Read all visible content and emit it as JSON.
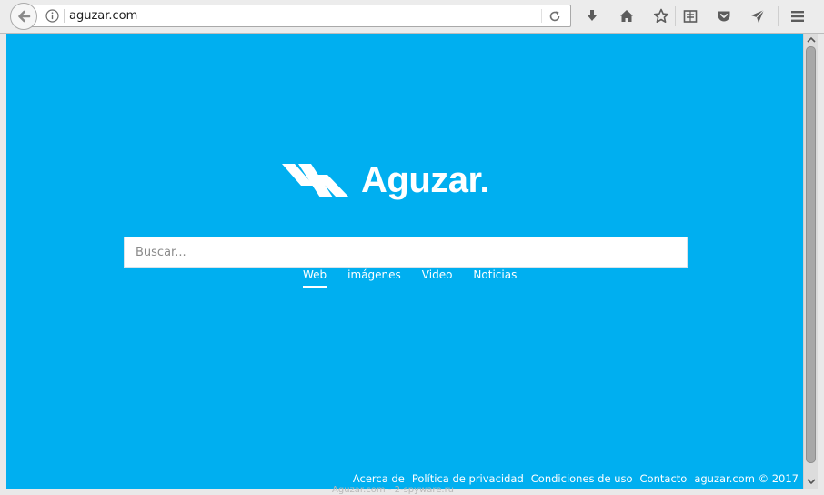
{
  "browser": {
    "url": "aguzar.com",
    "back_label": "Back",
    "reload_label": "Reload"
  },
  "toolbar_icons": [
    "download-icon",
    "home-icon",
    "bookmark-star-icon",
    "reading-list-icon",
    "pocket-icon",
    "send-tab-icon",
    "menu-hamburger-icon"
  ],
  "page": {
    "brand": "Aguzar.",
    "search_placeholder": "Buscar...",
    "tabs": [
      {
        "label": "Web",
        "active": true
      },
      {
        "label": "imágenes",
        "active": false
      },
      {
        "label": "Video",
        "active": false
      },
      {
        "label": "Noticias",
        "active": false
      }
    ],
    "footer": [
      "Acerca de",
      "Política de privacidad",
      "Condiciones de uso",
      "Contacto",
      "aguzar.com © 2017"
    ],
    "watermark": "Aguzar.com - 2-spyware.ru"
  },
  "colors": {
    "background": "#00aff0",
    "text": "#ffffff"
  }
}
